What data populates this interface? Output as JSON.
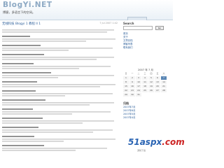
{
  "header": {
    "site_title": "BlogYi.NET",
    "tagline": "博客，多语言下的空间。"
  },
  "post": {
    "title": "无线科技 Blogyi 1 教程 II 1",
    "meta": "7 Jul 2007 1:42"
  },
  "sidebar": {
    "search_label": "Search",
    "search_button": "Go",
    "links": [
      "首页",
      "关于",
      "文章存档",
      "博客列表",
      "联系我们"
    ],
    "calendar_title": "2007 年 7 月",
    "weekdays": [
      "日",
      "一",
      "二",
      "三",
      "四",
      "五",
      "六"
    ],
    "archives_title": "归档",
    "archive_links": [
      "2007年7月",
      "2007年6月",
      "2007年5月",
      "2007年4月"
    ]
  },
  "watermark": {
    "prefix": "51aspx",
    "suffix": ".com",
    "sub": "源码下载"
  }
}
